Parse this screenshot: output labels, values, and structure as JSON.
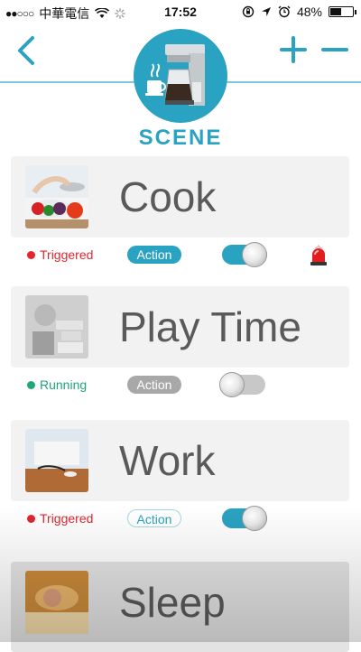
{
  "status_bar": {
    "carrier": "中華電信",
    "time": "17:52",
    "battery": "48%",
    "battery_level": 0.48
  },
  "header": {
    "title": "SCENE",
    "back_icon": "chevron-left-icon",
    "add_icon": "plus-icon",
    "remove_icon": "minus-icon",
    "scene_icon": "coffee-maker-icon"
  },
  "colors": {
    "accent": "#2aa2c1",
    "triggered": "#e0262f",
    "running": "#1fa67a",
    "card_bg": "#f2f2f2"
  },
  "scenes": [
    {
      "name": "Cook",
      "status": "Triggered",
      "action": "Action",
      "toggle_on": true,
      "alarm_icon": "siren-icon"
    },
    {
      "name": "Play Time",
      "status": "Running",
      "action": "Action",
      "toggle_on": false
    },
    {
      "name": "Work",
      "status": "Triggered",
      "action": "Action",
      "toggle_on": true
    },
    {
      "name": "Sleep"
    }
  ]
}
